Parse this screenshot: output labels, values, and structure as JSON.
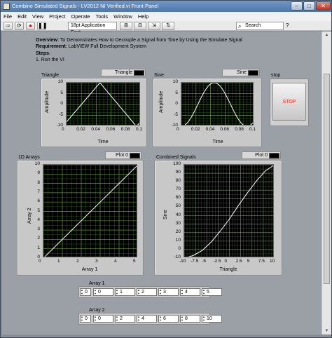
{
  "window": {
    "title": "Combine Simulated Signals - LV2012 NI Verified.vi Front Panel",
    "min_label": "–",
    "max_label": "□",
    "close_label": "✕"
  },
  "menu": [
    "File",
    "Edit",
    "View",
    "Project",
    "Operate",
    "Tools",
    "Window",
    "Help"
  ],
  "toolbar": {
    "font": "18pt Application Font",
    "search_placeholder": "Search",
    "help": "?"
  },
  "description": {
    "overview_label": "Overview",
    "overview_text": ": To Demonstrates How to Decouple a Signal from Time by Using the Simulate Signal",
    "requirement_label": "Requirement",
    "requirement_text": ": LabVIEW Full Development System",
    "steps_label": "Steps",
    "steps_text": ":",
    "step1": "1. Run the VI"
  },
  "graphs": {
    "triangle": {
      "label": "Triangle",
      "legend": "Triangle",
      "xlabel": "Time",
      "ylabel": "Amplitude"
    },
    "sine": {
      "label": "Sine",
      "legend": "Sine",
      "xlabel": "Time",
      "ylabel": "Amplitude"
    },
    "arrays1d": {
      "label": "1D Arrays",
      "legend": "Plot 0",
      "xlabel": "Array 1",
      "ylabel": "Array 2"
    },
    "combined": {
      "label": "Combined Signals",
      "legend": "Plot 0",
      "xlabel": "Triangle",
      "ylabel": "Sine"
    }
  },
  "stop": {
    "label": "stop",
    "button": "STOP"
  },
  "array1": {
    "label": "Array 1",
    "index": "0",
    "values": [
      "0",
      "1",
      "2",
      "3",
      "4",
      "5"
    ]
  },
  "array2": {
    "label": "Array 2",
    "index": "0",
    "values": [
      "0",
      "2",
      "4",
      "6",
      "8",
      "10"
    ]
  },
  "colors": {
    "plot_bg": "#000000",
    "grid": "#3e6a26",
    "trace": "#ffffff",
    "stop_text": "#e3271b"
  },
  "chart_data": [
    {
      "type": "line",
      "name": "Triangle",
      "xlabel": "Time",
      "ylabel": "Amplitude",
      "xlim": [
        0,
        0.1
      ],
      "ylim": [
        -10,
        10
      ],
      "xticks": [
        "0",
        "0.02",
        "0.04",
        "0.06",
        "0.08",
        "0.1"
      ],
      "yticks": [
        "10",
        "5",
        "0",
        "-5",
        "-10"
      ],
      "x": [
        0,
        0.045,
        0.094,
        0.1
      ],
      "y": [
        -8,
        10,
        -10,
        -8
      ]
    },
    {
      "type": "line",
      "name": "Sine",
      "xlabel": "Time",
      "ylabel": "Amplitude",
      "xlim": [
        0,
        0.1
      ],
      "ylim": [
        -10,
        10
      ],
      "xticks": [
        "0",
        "0.02",
        "0.04",
        "0.06",
        "0.08",
        "0.1"
      ],
      "yticks": [
        "10",
        "5",
        "0",
        "-5",
        "-10"
      ],
      "function": "sine",
      "period": 0.09,
      "peak_x": 0.045,
      "amplitude": 10
    },
    {
      "type": "line",
      "name": "1D Arrays",
      "xlabel": "Array 1",
      "ylabel": "Array 2",
      "xlim": [
        0,
        5
      ],
      "ylim": [
        0,
        10
      ],
      "xticks": [
        "0",
        "1",
        "2",
        "3",
        "4",
        "5"
      ],
      "yticks": [
        "10",
        "9",
        "8",
        "7",
        "6",
        "5",
        "4",
        "3",
        "2",
        "1",
        "0"
      ],
      "x": [
        0,
        1,
        2,
        3,
        4,
        5
      ],
      "y": [
        0,
        2,
        4,
        6,
        8,
        10
      ]
    },
    {
      "type": "line",
      "name": "Combined Signals",
      "xlabel": "Triangle",
      "ylabel": "Sine",
      "xlim": [
        -10,
        10
      ],
      "ylim": [
        -10,
        100
      ],
      "xticks": [
        "-10",
        "-7.5",
        "-5",
        "-2.5",
        "0",
        "2.5",
        "5",
        "7.5",
        "10"
      ],
      "yticks": [
        "100",
        "90",
        "80",
        "70",
        "60",
        "50",
        "40",
        "30",
        "20",
        "10",
        "0",
        "-10"
      ],
      "x": [
        -10,
        -8,
        -6,
        -4,
        -2,
        0,
        2,
        4,
        6,
        8,
        10
      ],
      "y": [
        -10,
        -7,
        -1,
        9,
        22,
        36,
        52,
        67,
        81,
        93,
        100
      ]
    }
  ]
}
